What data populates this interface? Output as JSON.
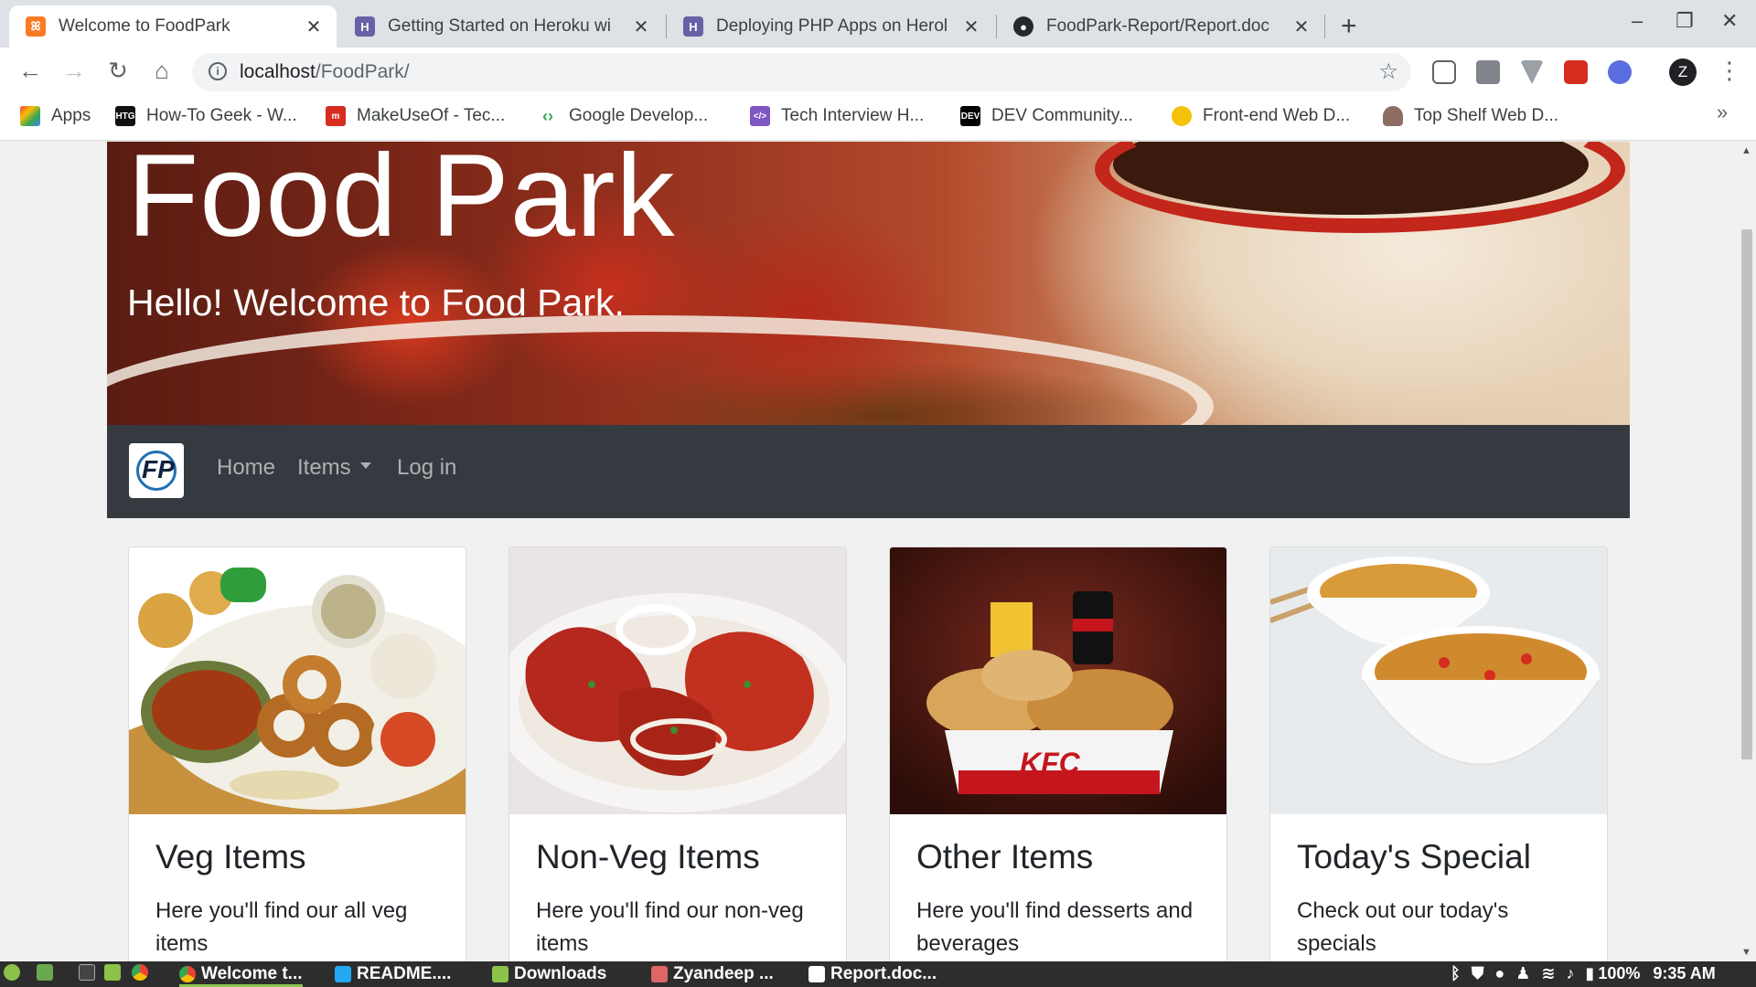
{
  "browser": {
    "tabs": [
      {
        "title": "Welcome to FoodPark",
        "active": true,
        "favicon": "xampp-icon",
        "favicon_color": "#fb7a24"
      },
      {
        "title": "Getting Started on Heroku wi",
        "active": false,
        "favicon": "heroku-icon",
        "favicon_color": "#6762a6"
      },
      {
        "title": "Deploying PHP Apps on Herol",
        "active": false,
        "favicon": "heroku-icon",
        "favicon_color": "#6762a6"
      },
      {
        "title": "FoodPark-Report/Report.doc",
        "active": false,
        "favicon": "github-icon",
        "favicon_color": "#24292e"
      }
    ],
    "new_tab_glyph": "+",
    "window_controls": {
      "minimize": "–",
      "restore": "❐",
      "close": "✕"
    },
    "omnibox": {
      "host": "localhost",
      "path": "/FoodPark/"
    },
    "profile_initial": "Z",
    "bookmarks": [
      {
        "label": "Apps",
        "icon": "apps-grid-icon",
        "color": "#4285f4"
      },
      {
        "label": "How-To Geek - W...",
        "icon": "htg-icon",
        "color": "#111111"
      },
      {
        "label": "MakeUseOf - Tec...",
        "icon": "makeuseof-icon",
        "color": "#d62d20"
      },
      {
        "label": "Google Develop...",
        "icon": "google-dev-icon",
        "color": "#34a853"
      },
      {
        "label": "Tech Interview H...",
        "icon": "code-icon",
        "color": "#7e57c2"
      },
      {
        "label": "DEV Community...",
        "icon": "dev-icon",
        "color": "#000000"
      },
      {
        "label": "Front-end Web D...",
        "icon": "frontend-icon",
        "color": "#f4c20d"
      },
      {
        "label": "Top Shelf Web D...",
        "icon": "topshelf-icon",
        "color": "#8d6e63"
      }
    ],
    "bookmarks_more": "»"
  },
  "page": {
    "hero": {
      "title": "Food Park",
      "subtitle": "Hello! Welcome to Food Park."
    },
    "navbar": {
      "brand": "FP",
      "links": [
        {
          "label": "Home"
        },
        {
          "label": "Items",
          "dropdown": true
        },
        {
          "label": "Log in"
        }
      ],
      "bg_color": "#343a40"
    },
    "cards": [
      {
        "title": "Veg Items",
        "text": "Here you'll find our all veg items",
        "image": "veg-thali-image"
      },
      {
        "title": "Non-Veg Items",
        "text": "Here you'll find our non-veg items",
        "image": "tandoori-chicken-image"
      },
      {
        "title": "Other Items",
        "text": "Here you'll find desserts and beverages",
        "image": "kfc-meal-image",
        "image_text": "KFC"
      },
      {
        "title": "Today's Special",
        "text": "Check out our today's specials",
        "image": "noodles-image"
      }
    ]
  },
  "taskbar": {
    "tasks": [
      {
        "label": "Welcome t...",
        "icon": "chrome-icon",
        "active": true
      },
      {
        "label": "README....",
        "icon": "vscode-icon",
        "active": false
      },
      {
        "label": "Downloads",
        "icon": "folder-icon",
        "active": false
      },
      {
        "label": "Zyandeep ...",
        "icon": "paint-icon",
        "active": false
      },
      {
        "label": "Report.doc...",
        "icon": "document-icon",
        "active": false
      }
    ],
    "battery": "100%",
    "clock": "9:35 AM"
  }
}
